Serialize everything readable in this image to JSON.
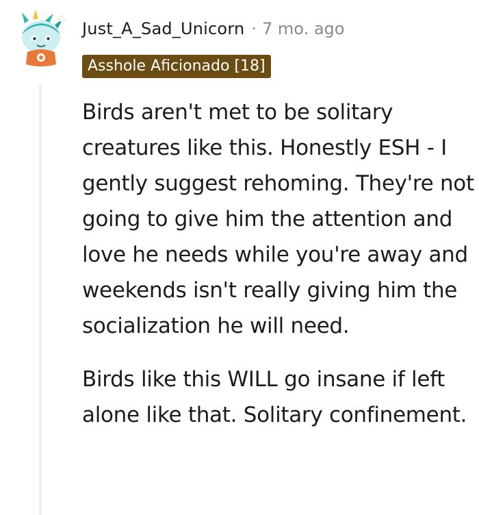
{
  "comment": {
    "author": "Just_A_Sad_Unicorn",
    "separator": "·",
    "timestamp": "7 mo. ago",
    "flair": "Asshole Aficionado [18]",
    "avatar_icon": "snoo-unicorn-avatar-icon",
    "paragraphs": [
      "Birds aren't met to be solitary creatures like this. Honestly ESH - I gently suggest rehoming. They're not going to give him the attention and love he needs while you're away and weekends isn't really giving him the socialization he will need.",
      "Birds like this WILL go insane if left alone like that. Solitary confinement."
    ]
  },
  "colors": {
    "flair_background": "#6b4c12",
    "flair_text": "#ffffff",
    "meta_text": "#878a8c",
    "body_text": "#1c1c1c",
    "thread_line": "#edeff1"
  }
}
